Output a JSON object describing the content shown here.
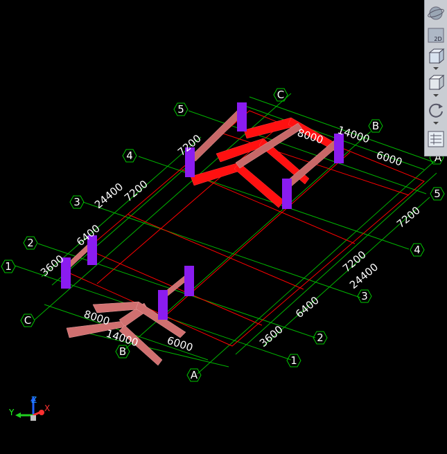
{
  "grid_bubbles": {
    "top_5": "5",
    "top_4": "4",
    "top_3": "3",
    "top_2": "2",
    "top_1": "1",
    "top_c": "C",
    "top_b": "B",
    "top_a": "A",
    "right_5": "5",
    "right_4": "4",
    "right_3": "3",
    "right_2": "2",
    "right_1": "1",
    "bot_c": "C",
    "bot_b": "B",
    "bot_a": "A"
  },
  "dims": {
    "left_7200_a": "7200",
    "left_24400": "24400",
    "left_7200_b": "7200",
    "left_6400": "6400",
    "left_3600": "3600",
    "top_8000": "8000",
    "top_14000": "14000",
    "top_6000": "6000",
    "bot_8000": "8000",
    "bot_14000": "14000",
    "bot_6000": "6000",
    "right_7200_a": "7200",
    "right_7200_b": "7200",
    "right_24400": "24400",
    "right_6400": "6400",
    "right_3600": "3600"
  },
  "toolbar": {
    "view_2d_label": "2D"
  },
  "axes": {
    "x": "X",
    "y": "Y",
    "z": "Z"
  },
  "colors": {
    "grid": "#00c800",
    "beam_red": "#ff0000",
    "beam_pink": "#d86a6a",
    "column": "#8a1cf0",
    "background": "#000000"
  }
}
